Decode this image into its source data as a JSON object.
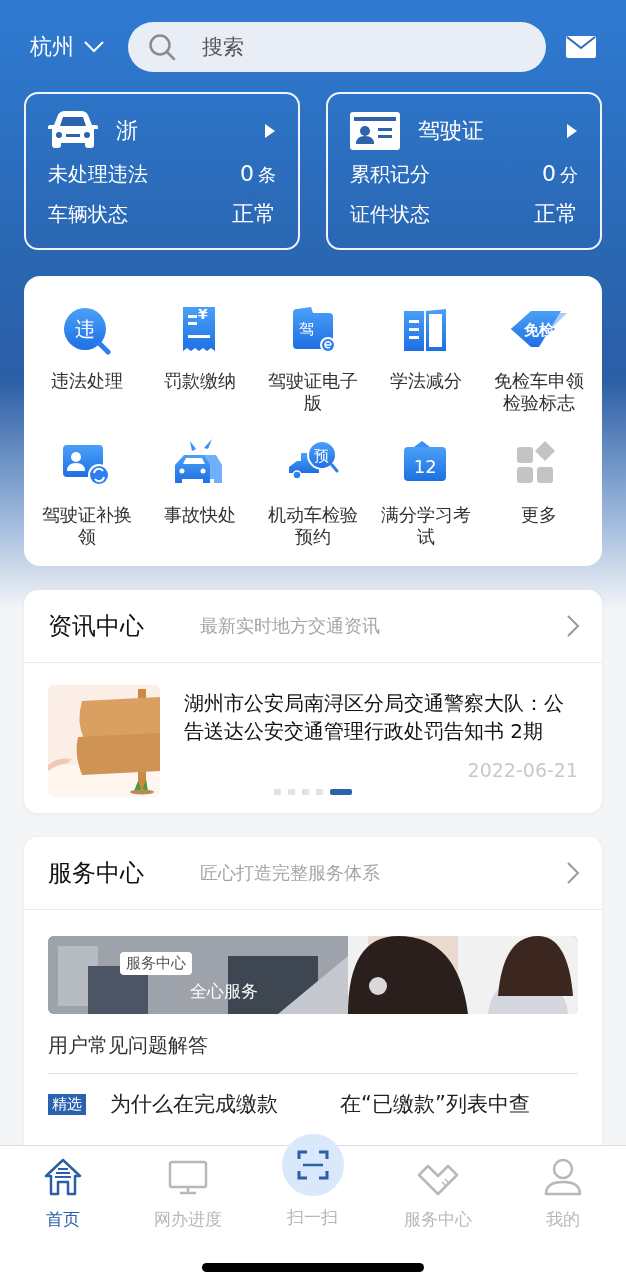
{
  "location": {
    "city": "杭州"
  },
  "search": {
    "placeholder": "搜索"
  },
  "cards": [
    {
      "kind": "vehicle",
      "title": "浙",
      "rows": [
        {
          "label": "未处理违法",
          "value": "0",
          "unit": "条"
        },
        {
          "label": "车辆状态",
          "value": "正常"
        }
      ]
    },
    {
      "kind": "license",
      "title": "驾驶证",
      "rows": [
        {
          "label": "累积记分",
          "value": "0",
          "unit": "分"
        },
        {
          "label": "证件状态",
          "value": "正常"
        }
      ]
    }
  ],
  "services": [
    {
      "kind": "violation",
      "badge": "违",
      "label": "违法处理"
    },
    {
      "kind": "fine",
      "badge": "¥",
      "label": "罚款缴纳"
    },
    {
      "kind": "elicense",
      "badge": "驾",
      "label": "驾驶证电子版"
    },
    {
      "kind": "study",
      "label": "学法减分"
    },
    {
      "kind": "exempt",
      "badge": "免检",
      "label": "免检车申领检验标志"
    },
    {
      "kind": "renew",
      "label": "驾驶证补换领"
    },
    {
      "kind": "accident",
      "label": "事故快处"
    },
    {
      "kind": "inspection",
      "badge": "预",
      "label": "机动车检验预约"
    },
    {
      "kind": "exam",
      "badge": "12",
      "label": "满分学习考试"
    },
    {
      "kind": "more",
      "label": "更多"
    }
  ],
  "news": {
    "title": "资讯中心",
    "subtitle": "最新实时地方交通资讯",
    "headline": "湖州市公安局南浔区分局交通警察大队：公告送达公安交通管理行政处罚告知书 2期",
    "date": "2022-06-21",
    "pager": [
      {
        "selected": false
      },
      {
        "selected": false
      },
      {
        "selected": false
      },
      {
        "selected": false
      },
      {
        "selected": true
      }
    ]
  },
  "service_center": {
    "title": "服务中心",
    "subtitle": "匠心打造完整服务体系",
    "banner": {
      "kind": "picture",
      "tag": "服务中心",
      "caption": "全心服务"
    },
    "faq_title": "用户常见问题解答",
    "faq": [
      {
        "tag": "精选",
        "text_start": "为什么在完成缴款",
        "text_end": "在“已缴款”列表中查"
      }
    ]
  },
  "tabs": [
    {
      "kind": "home",
      "label": "首页",
      "selected": true
    },
    {
      "kind": "progress",
      "label": "网办进度",
      "selected": false
    },
    {
      "kind": "scan",
      "label": "扫一扫",
      "selected": false
    },
    {
      "kind": "service",
      "label": "服务中心",
      "selected": false
    },
    {
      "kind": "mine",
      "label": "我的",
      "selected": false
    }
  ]
}
